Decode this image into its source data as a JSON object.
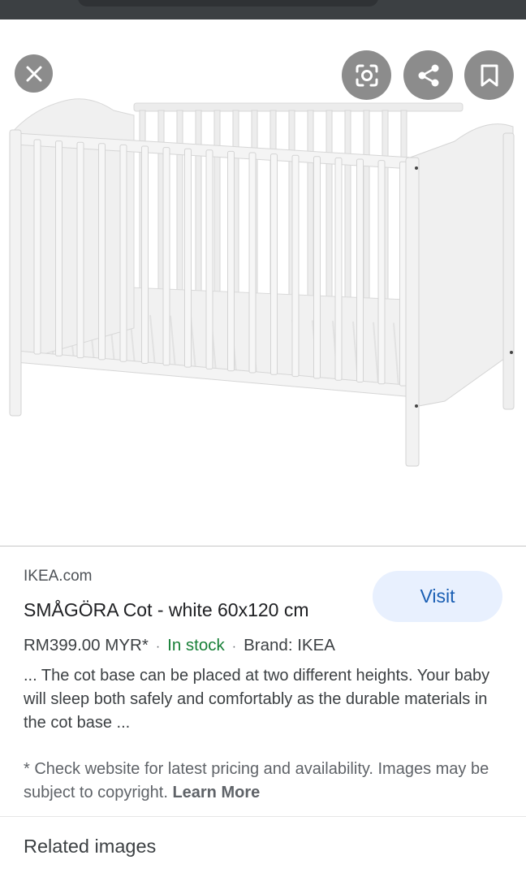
{
  "viewer": {
    "close_icon": "close-icon",
    "lens_icon": "lens-icon",
    "share_icon": "share-icon",
    "bookmark_icon": "bookmark-icon"
  },
  "result": {
    "source": "IKEA.com",
    "title": "SMÅGÖRA Cot - white 60x120 cm",
    "visit_label": "Visit",
    "price": "RM399.00 MYR*",
    "separator": "·",
    "availability": "In stock",
    "brand": "Brand: IKEA",
    "description": "... The cot base can be placed at two different heights. Your baby will sleep both safely and comfortably as the durable materials in the cot base ...",
    "disclaimer": "* Check website for latest pricing and availability. Images may be subject to copyright. ",
    "learn_more": "Learn More"
  },
  "related": {
    "heading": "Related images"
  },
  "colors": {
    "accent": "#1a5fb4",
    "in_stock": "#188038",
    "visit_bg": "#e8f0fe"
  }
}
